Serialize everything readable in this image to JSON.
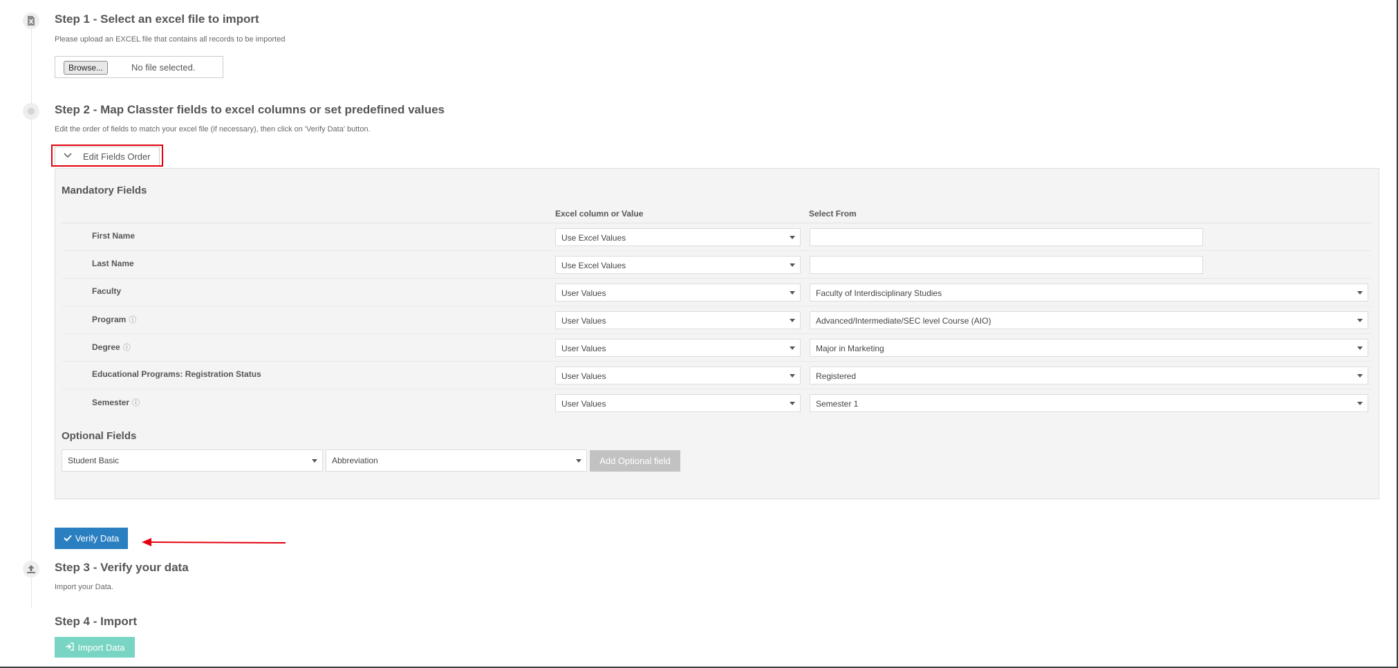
{
  "step1": {
    "title": "Step 1 - Select an excel file to import",
    "description": "Please upload an EXCEL file that contains all records to be imported",
    "browse_label": "Browse...",
    "file_status": "No file selected."
  },
  "step2": {
    "title": "Step 2 - Map Classter fields to excel columns or set predefined values",
    "description": "Edit the order of fields to match your excel file (if necessary), then click on 'Verify Data' button.",
    "edit_order_label": "Edit Fields Order",
    "mandatory_title": "Mandatory Fields",
    "col_excel": "Excel column or Value",
    "col_select": "Select From",
    "fields": [
      {
        "label": "First Name",
        "info": "",
        "mode": "Use Excel Values",
        "select": ""
      },
      {
        "label": "Last Name",
        "info": "",
        "mode": "Use Excel Values",
        "select": ""
      },
      {
        "label": "Faculty",
        "info": "",
        "mode": "User Values",
        "select": "Faculty of Interdisciplinary Studies"
      },
      {
        "label": "Program",
        "info": "ⓘ",
        "mode": "User Values",
        "select": "Advanced/Intermediate/SEC level Course (AIO)"
      },
      {
        "label": "Degree",
        "info": "ⓘ",
        "mode": "User Values",
        "select": "Major in Marketing"
      },
      {
        "label": "Educational Programs: Registration Status",
        "info": "",
        "mode": "User Values",
        "select": "Registered"
      },
      {
        "label": "Semester",
        "info": "ⓘ",
        "mode": "User Values",
        "select": "Semester 1"
      }
    ],
    "optional_title": "Optional Fields",
    "optional_group": "Student Basic",
    "optional_field": "Abbreviation",
    "add_optional_label": "Add Optional field",
    "verify_label": "Verify Data"
  },
  "step3": {
    "title": "Step 3 - Verify your data",
    "description": "Import your Data."
  },
  "step4": {
    "title": "Step 4 - Import",
    "import_label": "Import Data"
  },
  "icons": {
    "excel_file": "excel-file-icon",
    "step_circle": "circle-icon",
    "upload": "upload-icon",
    "chevron": "chevron-down-icon",
    "check": "check-icon",
    "sign_in": "sign-in-icon",
    "info": "info-icon"
  },
  "colors": {
    "primary": "#2a7fc1",
    "import_button": "#79d5c3",
    "annotation": "#e3000f",
    "disabled_button": "#c2c2c2",
    "panel_background": "#f4f4f4"
  }
}
